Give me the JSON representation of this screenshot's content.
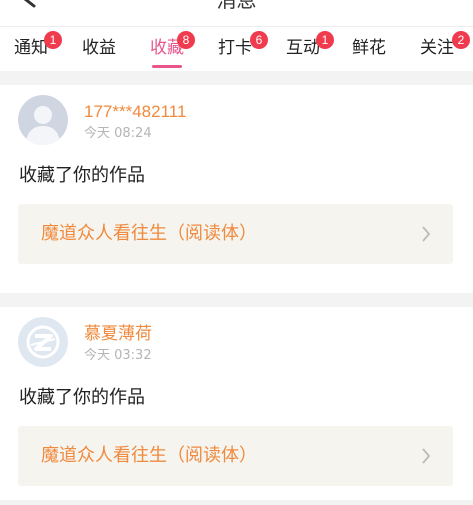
{
  "header": {
    "title": "消息"
  },
  "tabs": [
    {
      "label": "通知",
      "badge": "1"
    },
    {
      "label": "收益",
      "badge": ""
    },
    {
      "label": "收藏",
      "badge": "8",
      "active": true
    },
    {
      "label": "打卡",
      "badge": "6"
    },
    {
      "label": "互动",
      "badge": "1"
    },
    {
      "label": "鲜花",
      "badge": ""
    },
    {
      "label": "关注",
      "badge": "2"
    }
  ],
  "messages": [
    {
      "username": "177***482111",
      "time": "今天 08:24",
      "action": "收藏了你的作品",
      "work_title": "魔道众人看往生（阅读体）"
    },
    {
      "username": "慕夏薄荷",
      "time": "今天 03:32",
      "action": "收藏了你的作品",
      "work_title": "魔道众人看往生（阅读体）"
    }
  ],
  "colors": {
    "accent": "#e8568b",
    "username": "#f08a3e",
    "badge": "#f03a4d",
    "work_box_bg": "#f5f4ee"
  }
}
